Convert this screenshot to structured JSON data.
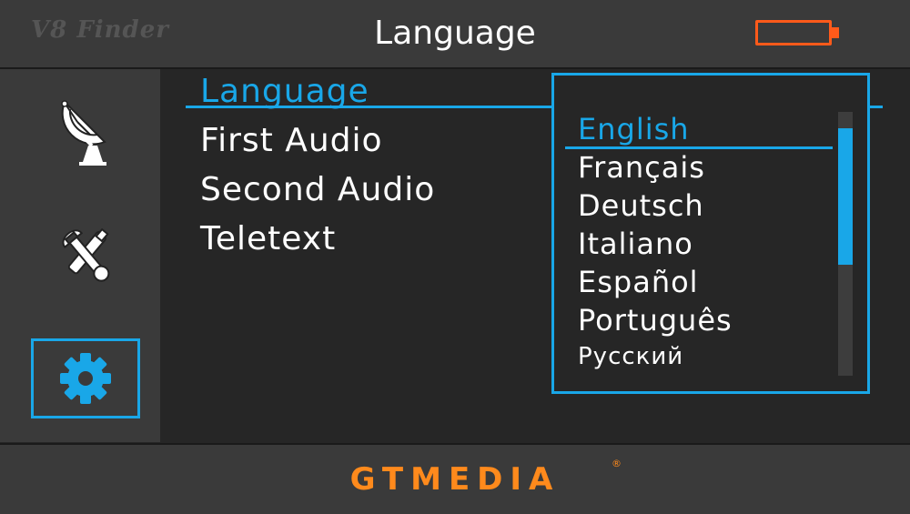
{
  "header": {
    "brand": "V8 Finder",
    "title": "Language",
    "battery_icon": "battery-icon"
  },
  "sidebar": {
    "items": [
      {
        "icon": "satellite-dish-icon",
        "selected": false
      },
      {
        "icon": "tools-icon",
        "selected": false
      },
      {
        "icon": "gear-icon",
        "selected": true
      }
    ]
  },
  "menu": {
    "items": [
      {
        "label": "Language",
        "active": true
      },
      {
        "label": "First Audio",
        "active": false
      },
      {
        "label": "Second Audio",
        "active": false
      },
      {
        "label": "Teletext",
        "active": false
      }
    ]
  },
  "language_list": {
    "items": [
      {
        "label": "English",
        "active": true
      },
      {
        "label": "Français",
        "active": false
      },
      {
        "label": "Deutsch",
        "active": false
      },
      {
        "label": "Italiano",
        "active": false
      },
      {
        "label": "Español",
        "active": false
      },
      {
        "label": "Português",
        "active": false
      },
      {
        "label": "Русский",
        "active": false
      }
    ]
  },
  "footer": {
    "logo": "GTMEDIA",
    "registered_mark": "®"
  },
  "colors": {
    "accent": "#19a7e8",
    "brand_orange": "#ff8a1c",
    "battery": "#ff5a1a",
    "panel_bg": "#3a3a3a",
    "content_bg": "#262626"
  }
}
